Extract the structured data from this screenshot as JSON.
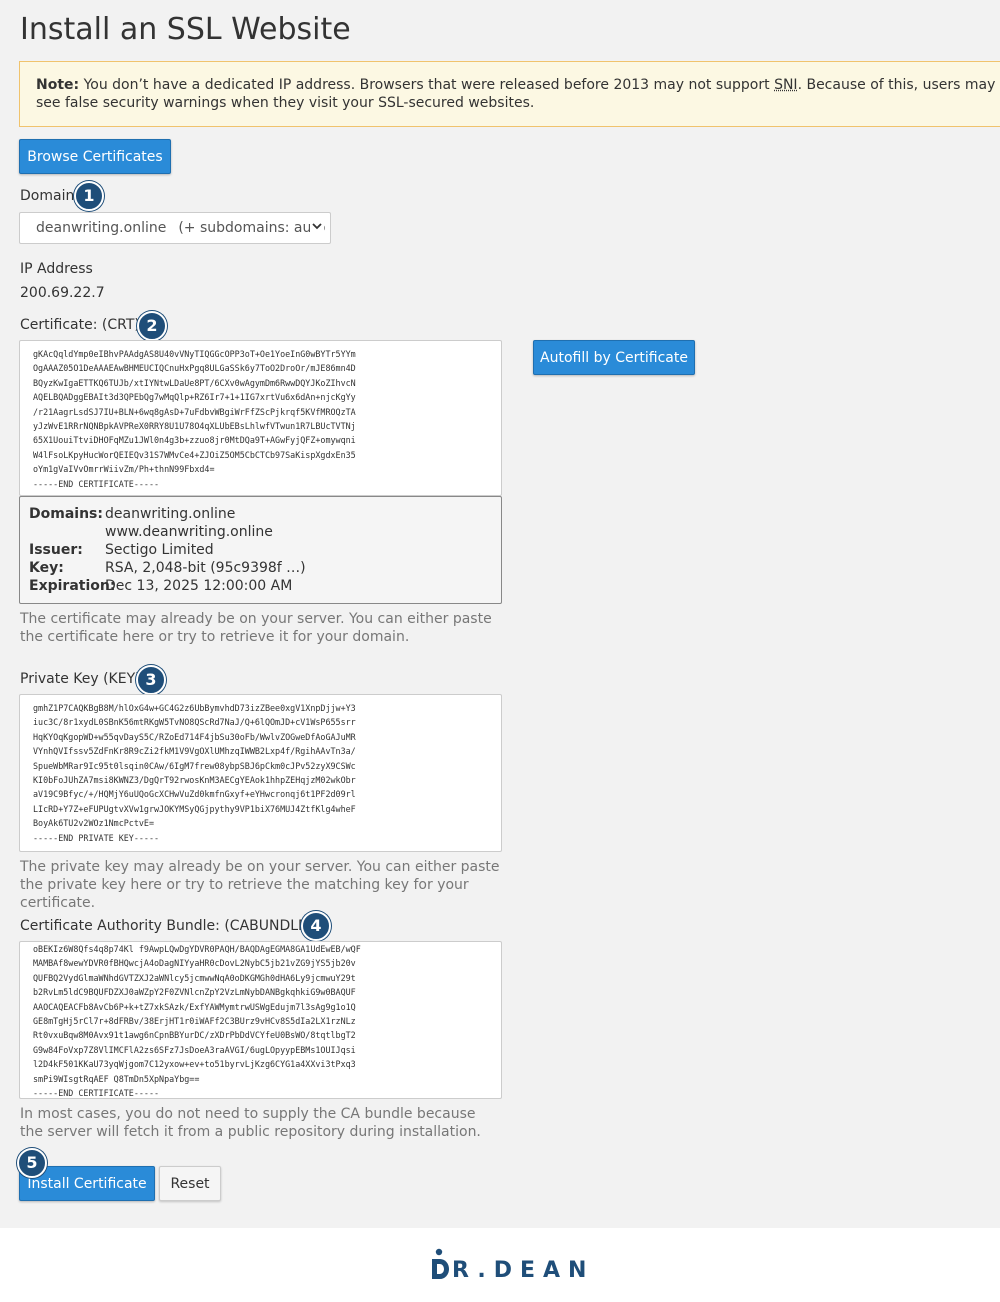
{
  "page_title": "Install an SSL Website",
  "note": {
    "label": "Note:",
    "text_before": " You don’t have a dedicated IP address. Browsers that were released before 2013 may not support ",
    "sni": "SNI",
    "text_after": ". Because of this, users may see false security warnings when they visit your SSL-secured websites."
  },
  "browse_button": "Browse Certificates",
  "domain": {
    "label": "Domain",
    "badge": "1",
    "selected": "deanwriting.online",
    "subdomains": "(+ subdomains: auto"
  },
  "ip": {
    "label": "IP Address",
    "value": "200.69.22.7"
  },
  "certificate": {
    "label": "Certificate: (CRT)",
    "badge": "2",
    "autofill_button": "Autofill by Certificate",
    "lines": [
      "gKAcQqldYmp0eIBhvPAAdgAS8U40vVNyTIQGGcOPP3oT+Oe1YoeInG0wBYTr5YYm",
      "OgAAAZ05O1DeAAAEAwBHMEUCIQCnuHxPgq8ULGaSSk6y7ToO2DroOr/mJE86mn4D",
      "BQyzKwIgaETTKQ6TUJb/xtIYNtwLDaUe8PT/6CXv0wAgymDm6RwwDQYJKoZIhvcN",
      "AQELBQADggEBAIt3d3QPEbQg7wMqQlp+RZ6Ir7+1+1IG7xrtVu6x6dAn+njcKgYy",
      "/r21AagrLsdSJ7IU+BLN+6wq8gAsD+7uFdbvWBgiWrFfZScPjkrqf5KVfMROQzTA",
      "yJzWvE1RRrNQNBpkAVPReX0RRY8U1U78O4qXLUbEBsLhlwfVTwun1R7LBUcTVTNj",
      "65X1UouiTtviDHOFqMZu1JWl0n4g3b+zzuo8jr0MtDQa9T+AGwFyjQFZ+omywqni",
      "W4lFsoLKpyHucWorQEIEQv31S7WMvCe4+ZJOiZ5OM5CbCTCb97SaKispXgdxEn35",
      "oYm1gVaIVvOmrrWiivZm/Ph+thnN99Fbxd4=",
      "-----END CERTIFICATE-----"
    ],
    "info": {
      "domains_label": "Domains:",
      "domains": [
        "deanwriting.online",
        "www.deanwriting.online"
      ],
      "issuer_label": "Issuer:",
      "issuer": "Sectigo Limited",
      "key_label": "Key:",
      "key": "RSA, 2,048-bit (95c9398f …)",
      "expiration_label": "Expiration:",
      "expiration": "Dec 13, 2025 12:00:00 AM"
    },
    "help": "The certificate may already be on your server. You can either paste the certificate here or try to retrieve it for your domain."
  },
  "private_key": {
    "label": "Private Key (KEY)",
    "badge": "3",
    "lines": [
      "gmhZ1P7CAQKBgB8M/hlOxG4w+GC4G2z6UbBymvhdD73izZBee0xgV1XnpDjjw+Y3",
      "iuc3C/8r1xydL0SBnK56mtRKgW5TvNO8QScRd7NaJ/Q+6lQOmJD+cV1WsP655srr",
      "HqKYOqKgopWD+w55qvDayS5C/RZoEd714F4jbSu30oFb/WwlvZOGweDfAoGAJuMR",
      "VYnhQVIfssv5ZdFnKr8R9cZi2fkM1V9VgOXlUMhzqIWWB2Lxp4f/RgihAAvTn3a/",
      "SpueWbMRar9Ic95t0lsqin0CAw/6IgM7frew08ybpSBJ6pCkm0cJPv52zyX9CSWc",
      "KI0bFoJUhZA7msi8KWNZ3/DgQrT92rwosKnM3AECgYEAok1hhpZEHqjzM02wkObr",
      "aV19C9Bfyc/+/HQMjY6uUQoGcXCHwVuZd0kmfnGxyf+eYHwcronqj6t1PF2d09rl",
      "LIcRD+Y7Z+eFUPUgtvXVw1grwJOKYMSyQGjpythy9VP1biX76MUJ4ZtfKlg4wheF",
      "BoyAk6TU2v2WOz1NmcPctvE=",
      "-----END PRIVATE KEY-----"
    ],
    "help": "The private key may already be on your server. You can either paste the private key here or try to retrieve the matching key for your certificate."
  },
  "ca_bundle": {
    "label": "Certificate Authority Bundle: (CABUNDLE)",
    "badge": "4",
    "lines": [
      "oBEKIz6W8Qfs4q8p74Kl f9AwpLQwDgYDVR0PAQH/BAQDAgEGMA8GA1UdEwEB/wQF",
      "MAMBAf8wewYDVR0fBHQwcjA4oDagNIYyaHR0cDovL2NybC5jb21vZG9jYS5jb20v",
      "QUFBQ2VydGlmaWNhdGVTZXJ2aWNlcy5jcmwwNqA0oDKGMGh0dHA6Ly9jcmwuY29t",
      "b2RvLm5ldC9BQUFDZXJ0aWZpY2F0ZVNlcnZpY2VzLmNybDANBgkqhkiG9w0BAQUF",
      "AAOCAQEACFb8AvCb6P+k+tZ7xkSAzk/ExfYAWMymtrwUSWgEdujm7l3sAg9g1o1Q",
      "GE8mTgHj5rCl7r+8dFRBv/38ErjHT1r0iWAFf2C3BUrz9vHCv8S5dIa2LX1rzNLz",
      "Rt0vxuBqw8M0Avx91t1awg6nCpnBBYurDC/zXDrPbDdVCYfeU0BsWO/8tqtlbgT2",
      "G9w84FoVxp7Z8VlIMCFlA2zs6SFz7JsDoeA3raAVGI/6ugLOpyypEBMs1OUIJqsi",
      "l2D4kF501KKaU73yqWjgom7C12yxow+ev+to51byrvLjKzg6CYG1a4XXvi3tPxq3",
      "smPi9WIsgtRqAEF Q8TmDn5XpNpaYbg==",
      "-----END CERTIFICATE-----"
    ],
    "help": "In most cases, you do not need to supply the CA bundle because the server will fetch it from a public repository during installation."
  },
  "actions": {
    "badge": "5",
    "install_button": "Install Certificate",
    "reset_button": "Reset"
  },
  "footer": {
    "logo_text": "R.DEAN"
  },
  "colors": {
    "primary": "#2a8bd8",
    "badge": "#1f4e79",
    "note_bg": "#fcf8e3",
    "note_border": "#f0c36d"
  }
}
